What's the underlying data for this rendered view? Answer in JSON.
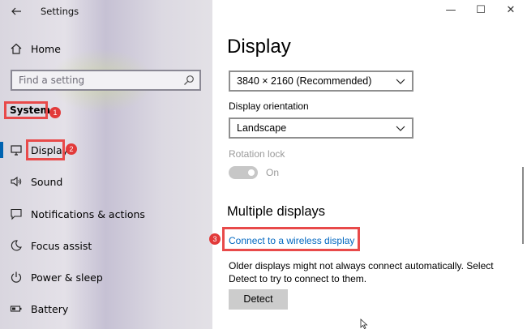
{
  "window": {
    "title": "Settings",
    "controls": {
      "minimize": "—",
      "maximize": "☐",
      "close": "✕"
    }
  },
  "sidebar": {
    "home_label": "Home",
    "search_placeholder": "Find a setting",
    "section_label": "System",
    "items": [
      {
        "label": "Display",
        "icon": "monitor-icon",
        "active": true
      },
      {
        "label": "Sound",
        "icon": "speaker-icon"
      },
      {
        "label": "Notifications & actions",
        "icon": "notification-icon"
      },
      {
        "label": "Focus assist",
        "icon": "moon-icon"
      },
      {
        "label": "Power & sleep",
        "icon": "power-icon"
      },
      {
        "label": "Battery",
        "icon": "battery-icon"
      }
    ]
  },
  "main": {
    "page_title": "Display",
    "resolution_value": "3840 × 2160 (Recommended)",
    "orientation_label": "Display orientation",
    "orientation_value": "Landscape",
    "rotation_lock_label": "Rotation lock",
    "rotation_lock_state": "On",
    "multiple_displays_title": "Multiple displays",
    "wireless_link": "Connect to a wireless display",
    "detect_description": "Older displays might not always connect automatically. Select Detect to try to connect to them.",
    "detect_button": "Detect"
  },
  "annotations": {
    "badge_1": "1",
    "badge_2": "2",
    "badge_3": "3"
  },
  "colors": {
    "accent": "#0067c0",
    "highlight": "#e84a4a",
    "badge": "#e23a3a"
  }
}
